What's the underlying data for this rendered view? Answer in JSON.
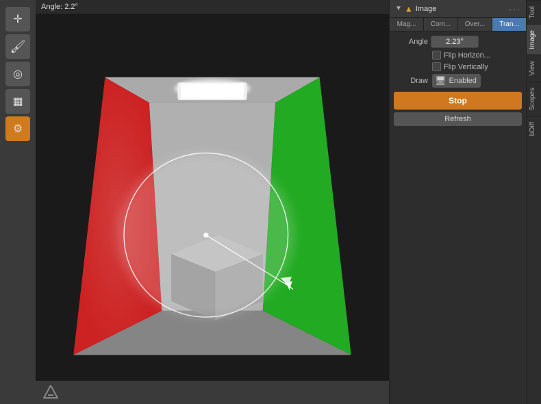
{
  "app": {
    "title": "Blender Image Editor"
  },
  "info_bar": {
    "angle_label": "Angle: 2.2°"
  },
  "toolbar": {
    "buttons": [
      {
        "id": "cursor",
        "icon": "✛",
        "active": false
      },
      {
        "id": "paint",
        "icon": "🖌",
        "active": false
      },
      {
        "id": "target",
        "icon": "◎",
        "active": false
      },
      {
        "id": "texture",
        "icon": "▦",
        "active": false
      },
      {
        "id": "gear",
        "icon": "⚙",
        "active": true
      }
    ]
  },
  "right_panel": {
    "header": {
      "collapse_icon": "▼",
      "triangle_icon": "▲",
      "title": "Image",
      "dots": "···"
    },
    "tabs": [
      {
        "id": "mag",
        "label": "Mag...",
        "active": false
      },
      {
        "id": "com",
        "label": "Com...",
        "active": false
      },
      {
        "id": "over",
        "label": "Over...",
        "active": false
      },
      {
        "id": "tran",
        "label": "Tran...",
        "active": true
      }
    ],
    "angle_label": "Angle",
    "angle_value": "2.23°",
    "flip_horiz_label": "Flip Horizon...",
    "flip_vert_label": "Flip Vertically",
    "draw_label": "Draw",
    "draw_icon": "🖥",
    "draw_value": "Enabled",
    "stop_label": "Stop",
    "refresh_label": "Refresh"
  },
  "vtabs": [
    {
      "id": "tool",
      "label": "Tool",
      "active": false
    },
    {
      "id": "image",
      "label": "Image",
      "active": true
    },
    {
      "id": "view",
      "label": "View",
      "active": false
    },
    {
      "id": "scopes",
      "label": "Scopes",
      "active": false
    },
    {
      "id": "bdiff",
      "label": "bDiff",
      "active": false
    }
  ],
  "bottom_bar": {
    "logo": "△"
  }
}
